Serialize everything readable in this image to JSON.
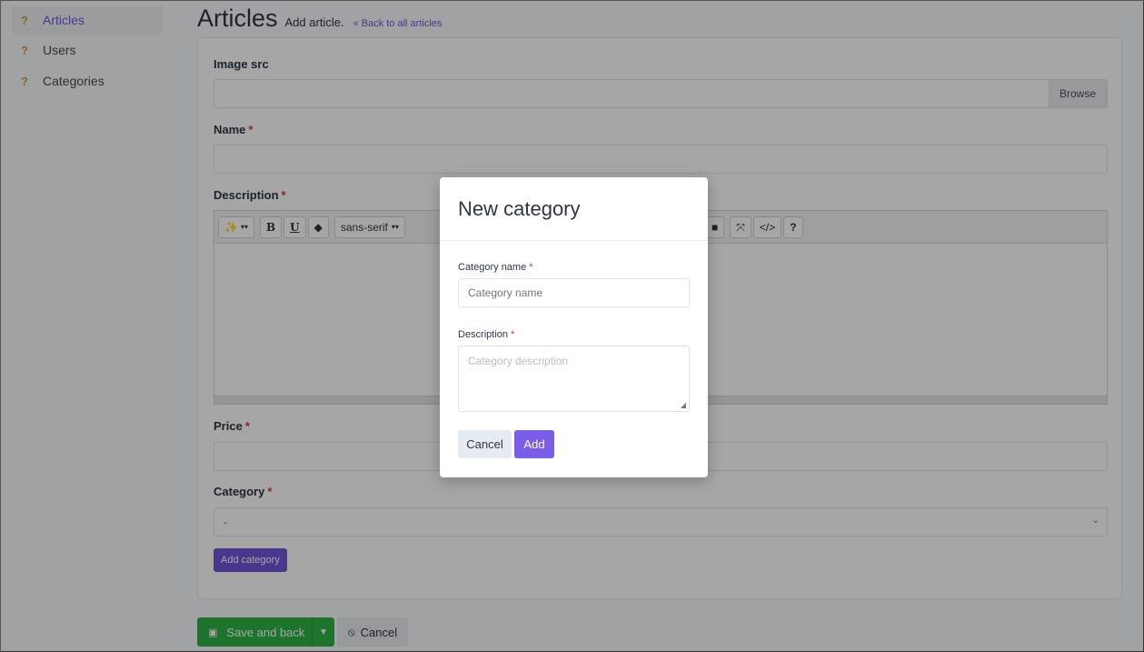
{
  "sidebar": {
    "items": [
      {
        "label": "Articles",
        "icon": "question-icon",
        "active": true
      },
      {
        "label": "Users",
        "icon": "question-icon"
      },
      {
        "label": "Categories",
        "icon": "question-icon"
      }
    ]
  },
  "header": {
    "title": "Articles",
    "subtitle": "Add article.",
    "back_link": "« Back to all articles"
  },
  "form": {
    "image_src_label": "Image src",
    "browse_label": "Browse",
    "name_label": "Name",
    "description_label": "Description",
    "price_label": "Price",
    "category_label": "Category",
    "category_value": "-",
    "add_category_label": "Add category",
    "required_mark": "*"
  },
  "editor_toolbar": {
    "font_name": "sans-serif",
    "bold": "B",
    "underline": "U",
    "help": "?",
    "code": "</>"
  },
  "actions": {
    "save_label": "Save and back",
    "cancel_label": "Cancel"
  },
  "modal": {
    "title": "New category",
    "name_label": "Category name",
    "name_placeholder": "Category name",
    "description_label": "Description",
    "description_placeholder": "Category description",
    "cancel_label": "Cancel",
    "add_label": "Add"
  },
  "colors": {
    "accent": "#6f55d6",
    "success": "#2fb344",
    "required": "#d63939"
  }
}
